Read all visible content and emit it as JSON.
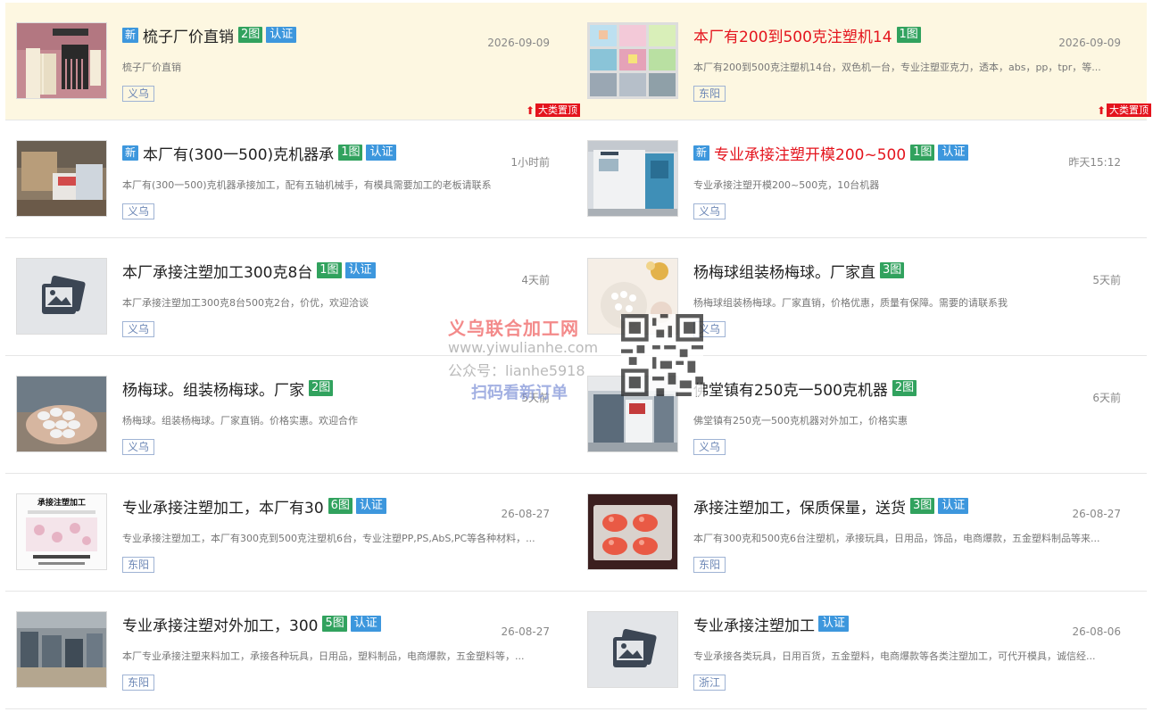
{
  "items": [
    {
      "title": "梳子厂价直销",
      "new": "新",
      "pics": "2图",
      "cert": "认证",
      "date": "2026-09-09",
      "desc": "梳子厂价直销",
      "loc": "义乌",
      "pin": "大类置顶",
      "red": false,
      "thumb": "comb"
    },
    {
      "title": "本厂有200到500克注塑机14",
      "new": "",
      "pics": "1图",
      "cert": "",
      "date": "2026-09-09",
      "desc": "本厂有200到500克注塑机14台，双色机一台，专业注塑亚克力，透本，abs，pp，tpr，等...",
      "loc": "东阳",
      "pin": "大类置顶",
      "red": true,
      "thumb": "grid"
    },
    {
      "title": "本厂有(300一500)克机器承",
      "new": "新",
      "pics": "1图",
      "cert": "认证",
      "date": "1小时前",
      "desc": "本厂有(300一500)克机器承接加工，配有五轴机械手，有模具需要加工的老板请联系",
      "loc": "义乌",
      "pin": "",
      "red": false,
      "thumb": "factory"
    },
    {
      "title": "专业承接注塑开模200~500",
      "new": "新",
      "pics": "1图",
      "cert": "认证",
      "date": "昨天15:12",
      "desc": "专业承接注塑开模200~500克，10台机器",
      "loc": "义乌",
      "pin": "",
      "red": true,
      "thumb": "machine"
    },
    {
      "title": "本厂承接注塑加工300克8台",
      "new": "",
      "pics": "1图",
      "cert": "认证",
      "date": "4天前",
      "desc": "本厂承接注塑加工300克8台500克2台，价优，欢迎洽谈",
      "loc": "义乌",
      "pin": "",
      "red": false,
      "thumb": "placeholder"
    },
    {
      "title": "杨梅球组装杨梅球。厂家直",
      "new": "",
      "pics": "3图",
      "cert": "",
      "date": "5天前",
      "desc": "杨梅球组装杨梅球。厂家直销，价格优惠，质量有保障。需要的请联系我",
      "loc": "义乌",
      "pin": "",
      "red": false,
      "thumb": "pearl"
    },
    {
      "title": "杨梅球。组装杨梅球。厂家",
      "new": "",
      "pics": "2图",
      "cert": "",
      "date": "5天前",
      "desc": "杨梅球。组装杨梅球。厂家直销。价格实惠。欢迎合作",
      "loc": "义乌",
      "pin": "",
      "red": false,
      "thumb": "hand"
    },
    {
      "title": "佛堂镇有250克一500克机器",
      "new": "",
      "pics": "2图",
      "cert": "",
      "date": "6天前",
      "desc": "佛堂镇有250克一500克机器对外加工，价格实惠",
      "loc": "义乌",
      "pin": "",
      "red": false,
      "thumb": "workshop"
    },
    {
      "title": "专业承接注塑加工，本厂有30",
      "new": "",
      "pics": "6图",
      "cert": "认证",
      "date": "26-08-27",
      "desc": "专业承接注塑加工，本厂有300克到500克注塑机6台，专业注塑PP,PS,AbS,PC等各种材料，...",
      "loc": "东阳",
      "pin": "",
      "red": false,
      "thumb": "poster"
    },
    {
      "title": "承接注塑加工，保质保量，送货",
      "new": "",
      "pics": "3图",
      "cert": "认证",
      "date": "26-08-27",
      "desc": "本厂有300克和500克6台注塑机，承接玩具，日用品，饰品，电商爆款，五金塑料制品等来...",
      "loc": "东阳",
      "pin": "",
      "red": false,
      "thumb": "red"
    },
    {
      "title": "专业承接注塑对外加工，300",
      "new": "",
      "pics": "5图",
      "cert": "认证",
      "date": "26-08-27",
      "desc": "本厂专业承接注塑来料加工，承接各种玩具，日用品，塑料制品，电商爆款，五金塑料等，...",
      "loc": "东阳",
      "pin": "",
      "red": false,
      "thumb": "line"
    },
    {
      "title": "专业承接注塑加工",
      "new": "",
      "pics": "",
      "cert": "认证",
      "date": "26-08-06",
      "desc": "专业承接各类玩具，日用百货，五金塑料，电商爆款等各类注塑加工，可代开模具，诚信经...",
      "loc": "浙江",
      "pin": "",
      "red": false,
      "thumb": "placeholder"
    }
  ],
  "watermark": {
    "title": "义乌联合加工网",
    "url": "www.yiwulianhe.com",
    "gzh": "公众号：lianhe5918",
    "scan": "扫码看新订单",
    "poster_text": "承接注塑加工"
  },
  "colors": {
    "accent": "#3d97dd",
    "pic_badge": "#31a25e",
    "red_title": "#e4141d",
    "pin": "#e4141d",
    "top_bg": "#fdf7e1"
  }
}
